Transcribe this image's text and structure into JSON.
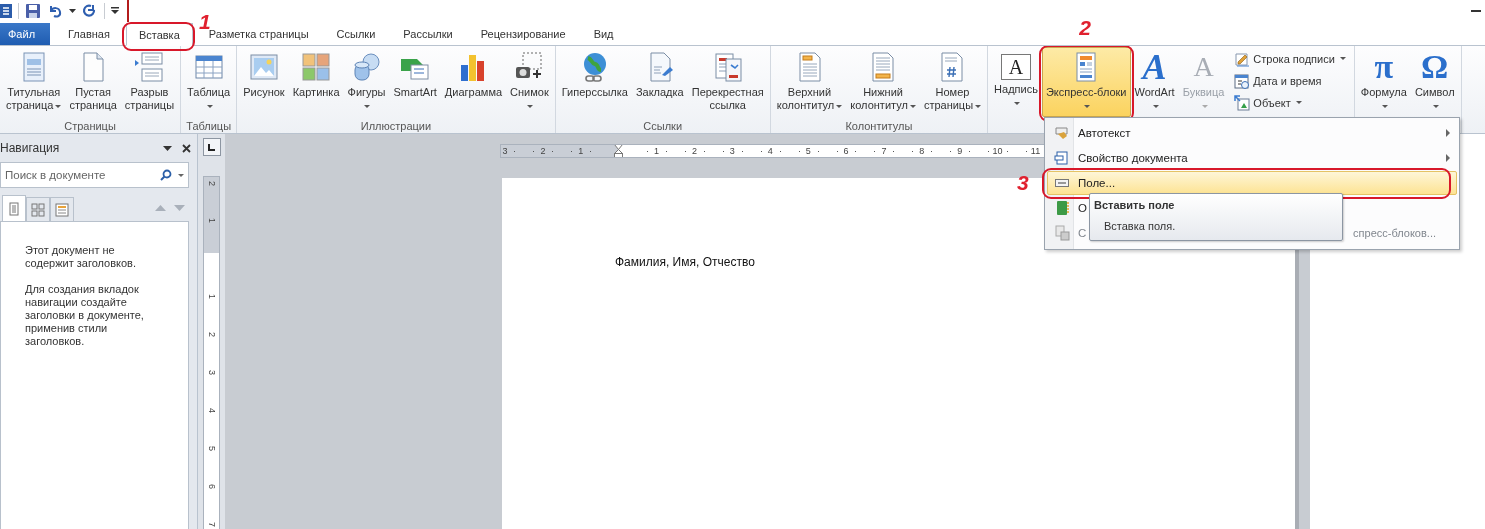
{
  "tabs": [
    {
      "label": "Файл",
      "kind": "file",
      "selected": false
    },
    {
      "label": "Главная",
      "kind": "tab",
      "selected": false
    },
    {
      "label": "Вставка",
      "kind": "tab",
      "selected": true,
      "callout": "1"
    },
    {
      "label": "Разметка страницы",
      "kind": "tab",
      "selected": false
    },
    {
      "label": "Ссылки",
      "kind": "tab",
      "selected": false
    },
    {
      "label": "Рассылки",
      "kind": "tab",
      "selected": false
    },
    {
      "label": "Рецензирование",
      "kind": "tab",
      "selected": false
    },
    {
      "label": "Вид",
      "kind": "tab",
      "selected": false
    }
  ],
  "ribbon": {
    "groups": [
      {
        "label": "Страницы",
        "buttons": [
          {
            "kind": "large",
            "lines": [
              "Титульная",
              "страница"
            ],
            "dropdown": true,
            "open": false,
            "disabled": false
          },
          {
            "kind": "large",
            "lines": [
              "Пустая",
              "страница"
            ],
            "dropdown": false,
            "open": false,
            "disabled": false
          },
          {
            "kind": "large",
            "lines": [
              "Разрыв",
              "страницы"
            ],
            "dropdown": false,
            "open": false,
            "disabled": false
          }
        ]
      },
      {
        "label": "Таблицы",
        "buttons": [
          {
            "kind": "large",
            "lines": [
              "Таблица"
            ],
            "dropdown": true,
            "open": false,
            "disabled": false
          }
        ]
      },
      {
        "label": "Иллюстрации",
        "buttons": [
          {
            "kind": "large",
            "lines": [
              "Рисунок"
            ],
            "dropdown": false,
            "open": false,
            "disabled": false
          },
          {
            "kind": "large",
            "lines": [
              "Картинка"
            ],
            "dropdown": false,
            "open": false,
            "disabled": false
          },
          {
            "kind": "large",
            "lines": [
              "Фигуры"
            ],
            "dropdown": true,
            "open": false,
            "disabled": false
          },
          {
            "kind": "large",
            "lines": [
              "SmartArt"
            ],
            "dropdown": false,
            "open": false,
            "disabled": false
          },
          {
            "kind": "large",
            "lines": [
              "Диаграмма"
            ],
            "dropdown": false,
            "open": false,
            "disabled": false
          },
          {
            "kind": "large",
            "lines": [
              "Снимок"
            ],
            "dropdown": true,
            "open": false,
            "disabled": false
          }
        ]
      },
      {
        "label": "Ссылки",
        "buttons": [
          {
            "kind": "large",
            "lines": [
              "Гиперссылка"
            ],
            "dropdown": false,
            "open": false,
            "disabled": false
          },
          {
            "kind": "large",
            "lines": [
              "Закладка"
            ],
            "dropdown": false,
            "open": false,
            "disabled": false
          },
          {
            "kind": "large",
            "lines": [
              "Перекрестная",
              "ссылка"
            ],
            "dropdown": false,
            "open": false,
            "disabled": false
          }
        ]
      },
      {
        "label": "Колонтитулы",
        "buttons": [
          {
            "kind": "large",
            "lines": [
              "Верхний",
              "колонтитул"
            ],
            "dropdown": true,
            "open": false,
            "disabled": false
          },
          {
            "kind": "large",
            "lines": [
              "Нижний",
              "колонтитул"
            ],
            "dropdown": true,
            "open": false,
            "disabled": false
          },
          {
            "kind": "large",
            "lines": [
              "Номер",
              "страницы"
            ],
            "dropdown": true,
            "open": false,
            "disabled": false
          }
        ]
      },
      {
        "buttons": [
          {
            "kind": "large",
            "glyph": "A",
            "lines": [
              "Надпись"
            ],
            "dropdown": true,
            "open": false,
            "disabled": false
          },
          {
            "kind": "large",
            "lines": [
              "Экспресс-блоки"
            ],
            "dropdown": true,
            "open": true,
            "disabled": false,
            "callout": "2"
          },
          {
            "kind": "large",
            "glyph": "A",
            "lines": [
              "WordArt"
            ],
            "dropdown": true,
            "open": false,
            "disabled": false
          },
          {
            "kind": "large",
            "glyph": "A",
            "lines": [
              "Буквица"
            ],
            "dropdown": true,
            "open": false,
            "disabled": true
          },
          {
            "kind": "small",
            "lines": [
              "Строка подписи"
            ],
            "dropdown": true,
            "open": false,
            "disabled": false
          },
          {
            "kind": "small",
            "lines": [
              "Дата и время"
            ],
            "dropdown": false,
            "open": false,
            "disabled": false
          },
          {
            "kind": "small",
            "lines": [
              "Объект"
            ],
            "dropdown": true,
            "open": false,
            "disabled": false
          }
        ]
      },
      {
        "buttons": [
          {
            "kind": "large",
            "glyph": "π",
            "lines": [
              "Формула"
            ],
            "dropdown": true,
            "open": false,
            "disabled": false
          },
          {
            "kind": "large",
            "glyph": "Ω",
            "lines": [
              "Символ"
            ],
            "dropdown": true,
            "open": false,
            "disabled": false
          }
        ]
      }
    ]
  },
  "navigation": {
    "title": "Навигация",
    "search_placeholder": "Поиск в документе",
    "views": [
      {
        "selected": true
      },
      {
        "selected": false
      },
      {
        "selected": false
      }
    ],
    "message": [
      "Этот документ не содержит заголовков.",
      "Для создания вкладок навигации создайте заголовки в документе, применив стили заголовков."
    ]
  },
  "ruler": {
    "horizontal": [
      "3",
      "2",
      "1",
      "1",
      "2",
      "3",
      "4",
      "5",
      "6",
      "7",
      "8",
      "9",
      "10",
      "11"
    ],
    "vertical": [
      "2",
      "1",
      "1",
      "2",
      "3",
      "4",
      "5",
      "6",
      "7"
    ]
  },
  "document": {
    "text": "Фамилия, Имя, Отчество"
  },
  "menu": {
    "items": [
      {
        "label": "Автотекст",
        "submenu": true,
        "highlighted": false,
        "disabled": false
      },
      {
        "label": "Свойство документа",
        "submenu": true,
        "highlighted": false,
        "disabled": false
      },
      {
        "label": "Поле...",
        "submenu": false,
        "highlighted": true,
        "disabled": false,
        "callout": "3"
      },
      {
        "label": "О",
        "submenu": false,
        "highlighted": false,
        "disabled": false
      },
      {
        "label": "С",
        "tail": "спресс-блоков...",
        "submenu": false,
        "highlighted": false,
        "disabled": true
      }
    ]
  },
  "tooltip": {
    "title": "Вставить поле",
    "text": "Вставка поля."
  }
}
